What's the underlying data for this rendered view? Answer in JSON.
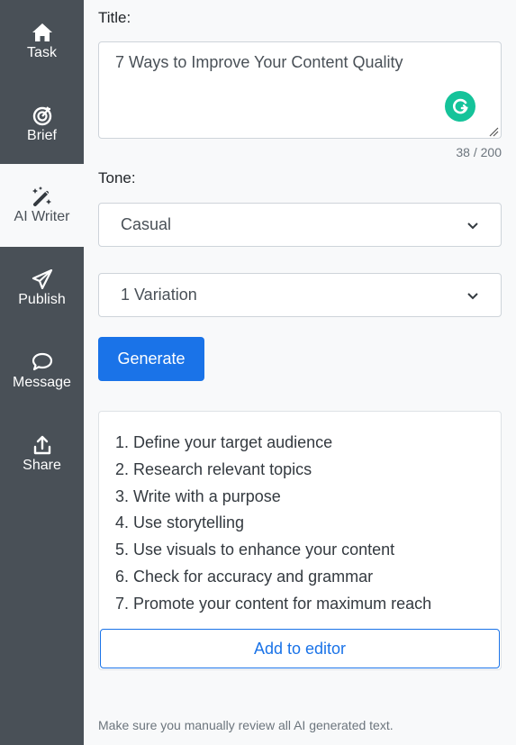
{
  "sidebar": {
    "items": [
      {
        "label": "Task",
        "icon": "home-icon",
        "active": false
      },
      {
        "label": "Brief",
        "icon": "target-icon",
        "active": false
      },
      {
        "label": "AI Writer",
        "icon": "magic-wand-icon",
        "active": true
      },
      {
        "label": "Publish",
        "icon": "paper-plane-icon",
        "active": false
      },
      {
        "label": "Message",
        "icon": "chat-bubble-icon",
        "active": false
      },
      {
        "label": "Share",
        "icon": "upload-icon",
        "active": false
      }
    ]
  },
  "form": {
    "title_label": "Title:",
    "title_value": "7 Ways to Improve Your Content Quality",
    "char_counter": "38 / 200",
    "tone_label": "Tone:",
    "tone_selected": "Casual",
    "variations_selected": "1 Variation",
    "generate_label": "Generate"
  },
  "result": {
    "items": [
      "1. Define your target audience",
      "2. Research relevant topics",
      "3. Write with a purpose",
      "4. Use storytelling",
      "5. Use visuals to enhance your content",
      "6. Check for accuracy and grammar",
      "7. Promote your content for maximum reach"
    ],
    "add_to_editor_label": "Add to editor"
  },
  "footnote": "Make sure you manually review all AI generated text.",
  "colors": {
    "sidebar_bg": "#495057",
    "primary": "#1a73e8",
    "grammarly": "#15c39a",
    "page_bg": "#f8f9fa"
  }
}
